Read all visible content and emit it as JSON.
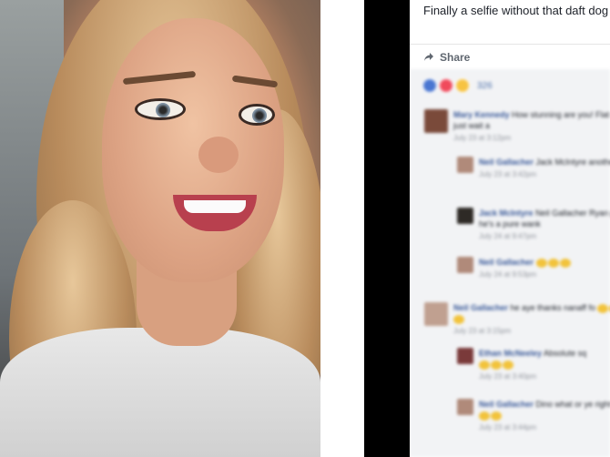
{
  "post": {
    "caption": "Finally a selfie without that daft dog",
    "share_label": "Share"
  },
  "reactions": {
    "count": "326"
  },
  "comments": [
    {
      "name": "Mary Kennedy",
      "text": "How stunning are you! Flat or just wait a",
      "time": "July 23 at 3:12pm"
    },
    {
      "name": "Neil Gallacher",
      "text": "Jack McIntyre another",
      "time": "July 23 at 3:42pm"
    },
    {
      "name": "Jack McIntyre",
      "text": "Neil Gallacher Ryan phone, he's a pure wank",
      "time": "July 24 at 9:47pm"
    },
    {
      "name": "Neil Gallacher",
      "text": "",
      "time": "July 24 at 9:53pm"
    },
    {
      "name": "Neil Gallacher",
      "text": "he aye thanks nanaff fo",
      "time": "July 23 at 3:15pm"
    },
    {
      "name": "Ethan McNeeley",
      "text": "Absolute sq",
      "time": "July 23 at 3:40pm"
    },
    {
      "name": "Neil Gallacher",
      "text": "Dino what or ye right now",
      "time": "July 23 at 3:44pm"
    }
  ]
}
